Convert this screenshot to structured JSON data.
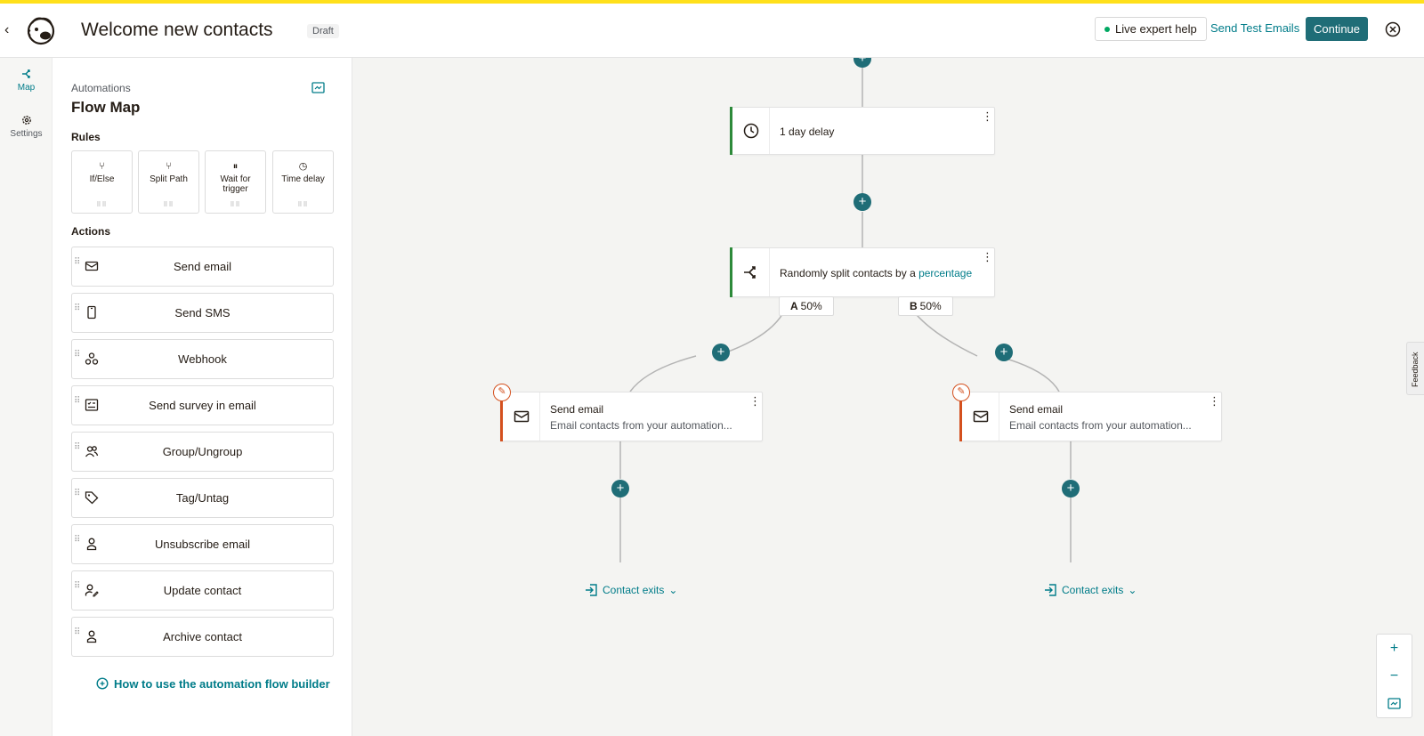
{
  "header": {
    "back_glyph": "‹",
    "title": "Welcome new contacts",
    "status_badge": "Draft",
    "live_help": "Live expert help",
    "send_test": "Send Test Emails",
    "continue": "Continue"
  },
  "rail": {
    "items": [
      {
        "label": "Map",
        "icon": "split-icon",
        "active": true
      },
      {
        "label": "Settings",
        "icon": "gear-icon",
        "active": false
      }
    ]
  },
  "panel": {
    "kicker": "Automations",
    "title": "Flow Map",
    "rules_label": "Rules",
    "rules": [
      {
        "label": "If/Else",
        "icon": "branch-icon"
      },
      {
        "label": "Split Path",
        "icon": "split-icon"
      },
      {
        "label": "Wait for trigger",
        "icon": "pause-icon"
      },
      {
        "label": "Time delay",
        "icon": "clock-icon"
      }
    ],
    "actions_label": "Actions",
    "actions": [
      {
        "label": "Send email",
        "icon": "envelope-icon"
      },
      {
        "label": "Send SMS",
        "icon": "phone-icon"
      },
      {
        "label": "Webhook",
        "icon": "webhook-icon"
      },
      {
        "label": "Send survey in email",
        "icon": "survey-icon"
      },
      {
        "label": "Group/Ungroup",
        "icon": "group-icon"
      },
      {
        "label": "Tag/Untag",
        "icon": "tag-icon"
      },
      {
        "label": "Unsubscribe email",
        "icon": "person-icon"
      },
      {
        "label": "Update contact",
        "icon": "edit-person-icon"
      },
      {
        "label": "Archive contact",
        "icon": "person-icon"
      }
    ],
    "howto": "How to use the automation flow builder"
  },
  "canvas": {
    "delay_node": {
      "text": "1 day delay"
    },
    "split_node": {
      "text_before": "Randomly split contacts by a ",
      "text_link": "percentage"
    },
    "branch_a": {
      "letter": "A",
      "percent": "50%"
    },
    "branch_b": {
      "letter": "B",
      "percent": "50%"
    },
    "email_nodes": [
      {
        "title": "Send email",
        "subtitle": "Email contacts from your automation..."
      },
      {
        "title": "Send email",
        "subtitle": "Email contacts from your automation..."
      }
    ],
    "exits": [
      "Contact exits",
      "Contact exits"
    ],
    "plus_glyph": "+",
    "feedback": "Feedback",
    "zoom": {
      "in": "+",
      "out": "−"
    }
  },
  "colors": {
    "accent": "#007c89",
    "button": "#1f6d77",
    "warning": "#d4501e",
    "success": "#2d8a3a",
    "yellow": "#ffe01b"
  }
}
